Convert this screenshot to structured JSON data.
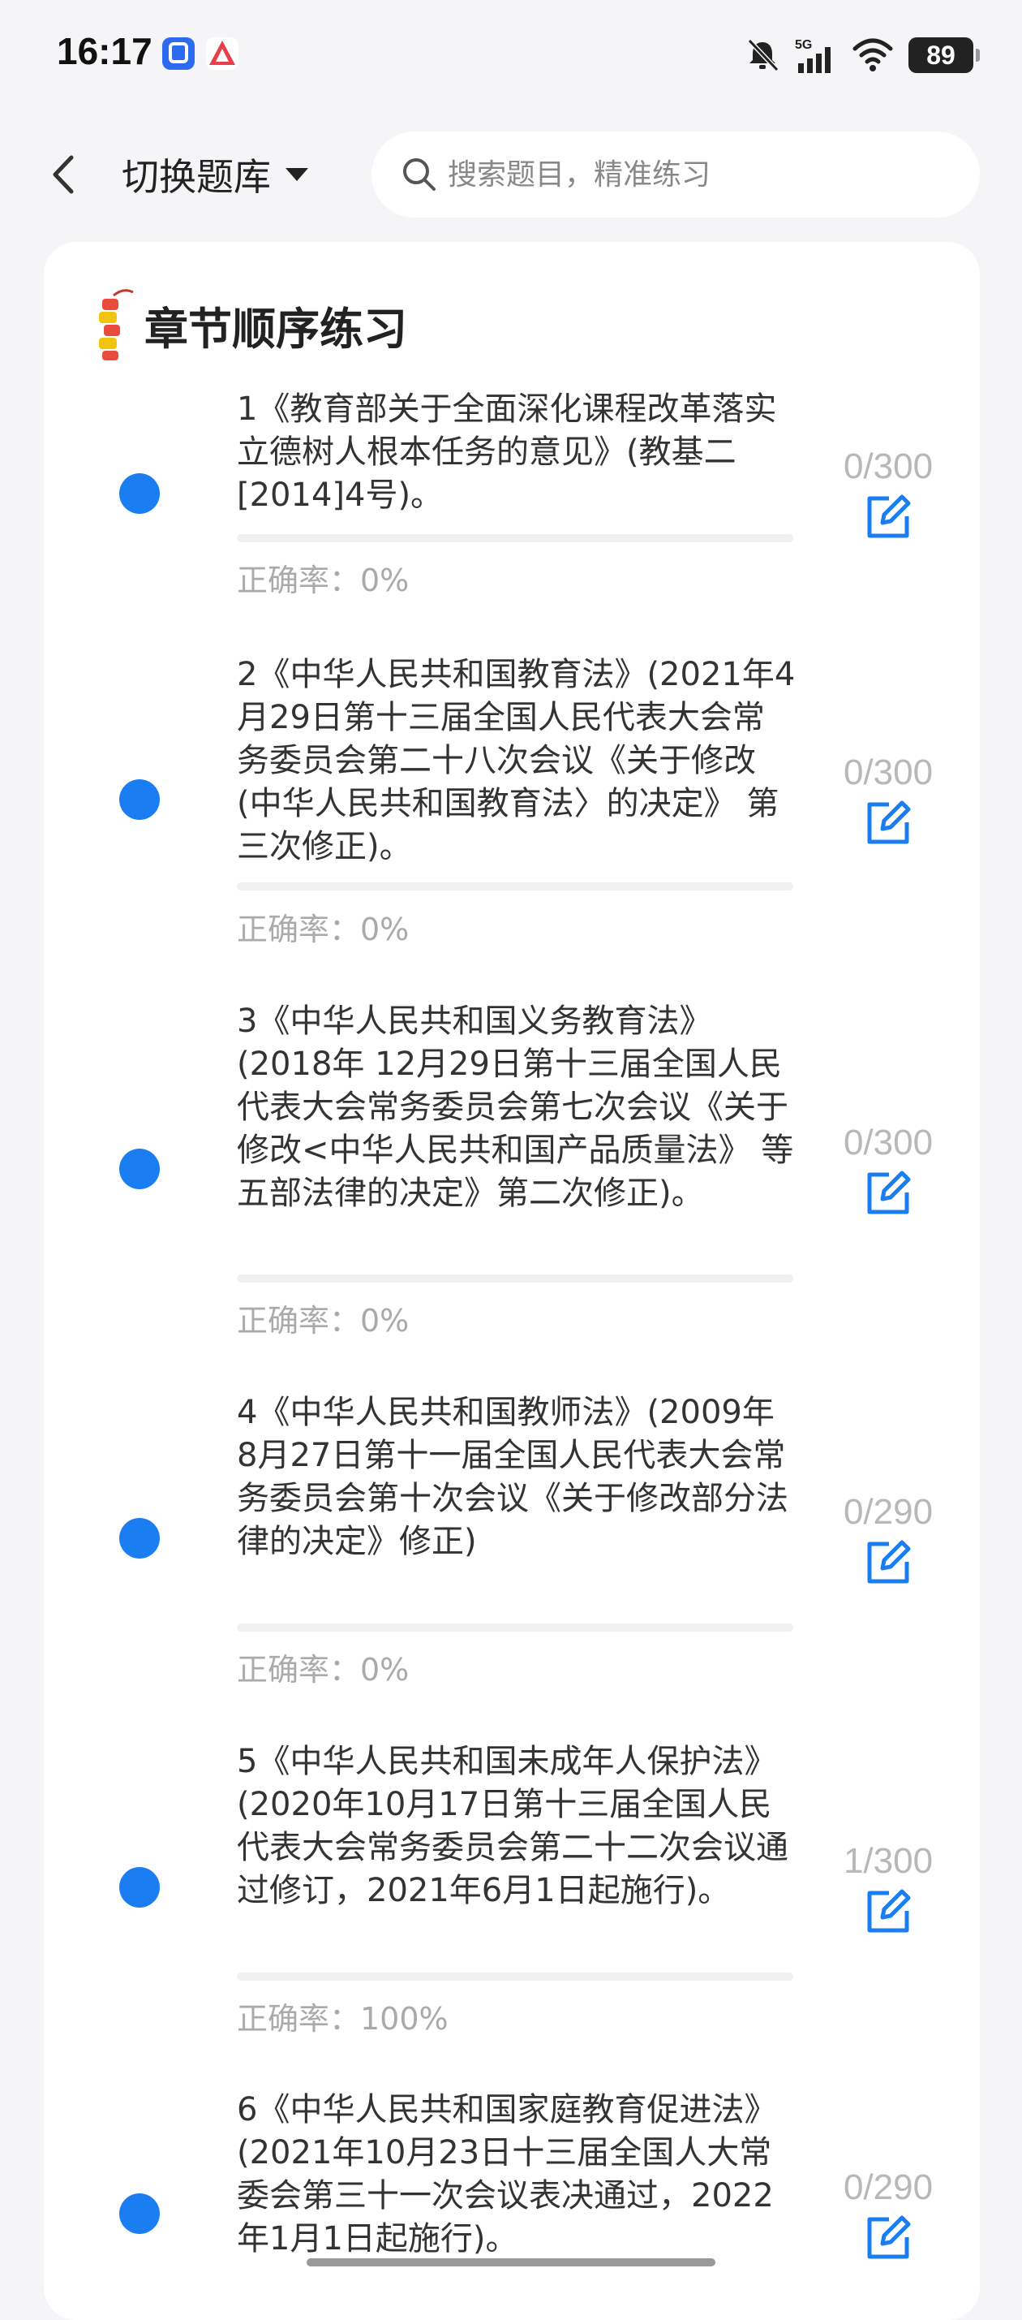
{
  "status_bar": {
    "time": "16:17",
    "battery": "89"
  },
  "header": {
    "switch_label": "切换题库",
    "search_placeholder": "搜索题目，精准练习"
  },
  "section": {
    "title": "章节顺序练习"
  },
  "chapters": [
    {
      "title": "1《教育部关于全面深化课程改革落实立德树人根本任务的意见》(教基二[2014]4号)。",
      "count": "0/300",
      "accuracy": "正确率：0%"
    },
    {
      "title": "2《中华人民共和国教育法》(2021年4月29日第十三届全国人民代表大会常务委员会第二十八次会议《关于修改(中华人民共和国教育法〉的决定》 第三次修正)。",
      "count": "0/300",
      "accuracy": "正确率：0%"
    },
    {
      "title": "3《中华人民共和国义务教育法》(2018年 12月29日第十三届全国人民代表大会常务委员会第七次会议《关于修改<中华人民共和国产品质量法》 等五部法律的决定》第二次修正)。",
      "count": "0/300",
      "accuracy": "正确率：0%"
    },
    {
      "title": "4《中华人民共和国教师法》(2009年 8月27日第十一届全国人民代表大会常务委员会第十次会议《关于修改部分法律的决定》修正)",
      "count": "0/290",
      "accuracy": "正确率：0%"
    },
    {
      "title": "5《中华人民共和国未成年人保护法》(2020年10月17日第十三届全国人民代表大会常务委员会第二十二次会议通过修订，2021年6月1日起施行)。",
      "count": "1/300",
      "accuracy": "正确率：100%"
    },
    {
      "title": "6《中华人民共和国家庭教育促进法》(2021年10月23日十三届全国人大常委会第三十一次会议表决通过，2022年1月1日起施行)。",
      "count": "0/290",
      "accuracy": ""
    }
  ]
}
